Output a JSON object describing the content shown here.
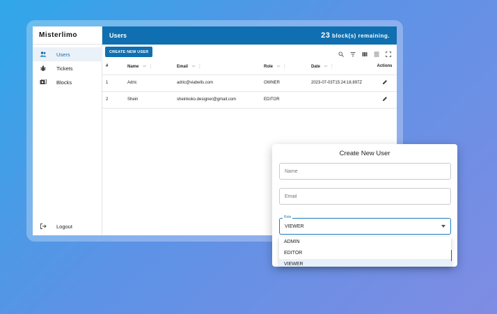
{
  "app": {
    "brand": "Misterlimo",
    "page_title": "Users",
    "blocks_remaining_count": "23",
    "blocks_remaining_label": " block(s) remaining."
  },
  "sidebar": {
    "items": [
      {
        "label": "Users",
        "icon": "users-icon",
        "active": true
      },
      {
        "label": "Tickets",
        "icon": "ticket-icon",
        "active": false
      },
      {
        "label": "Blocks",
        "icon": "blocks-icon",
        "active": false
      }
    ],
    "logout_label": "Logout"
  },
  "toolbar": {
    "create_label": "CREATE NEW USER",
    "icons": [
      "search-icon",
      "filter-icon",
      "columns-icon",
      "density-icon",
      "fullscreen-icon"
    ]
  },
  "table": {
    "headers": {
      "id": "#",
      "name": "Name",
      "email": "Email",
      "role": "Role",
      "date": "Date",
      "actions": "Actions"
    },
    "rows": [
      {
        "id": "1",
        "name": "Adric",
        "email": "adric@viabells.com",
        "role": "OWNER",
        "date": "2023-07-03T15:24:18.897Z"
      },
      {
        "id": "2",
        "name": "Shein",
        "email": "sheinkoko.designer@gmail.com",
        "role": "EDITOR",
        "date": ""
      }
    ]
  },
  "modal": {
    "title": "Create New User",
    "name_placeholder": "Name",
    "email_placeholder": "Email",
    "role_label": "Role",
    "role_value": "VIEWER",
    "role_options": [
      "ADMIN",
      "EDITOR",
      "VIEWER"
    ]
  },
  "colors": {
    "primary": "#0f6fb0",
    "sidebar_active": "#eaf1f8"
  }
}
